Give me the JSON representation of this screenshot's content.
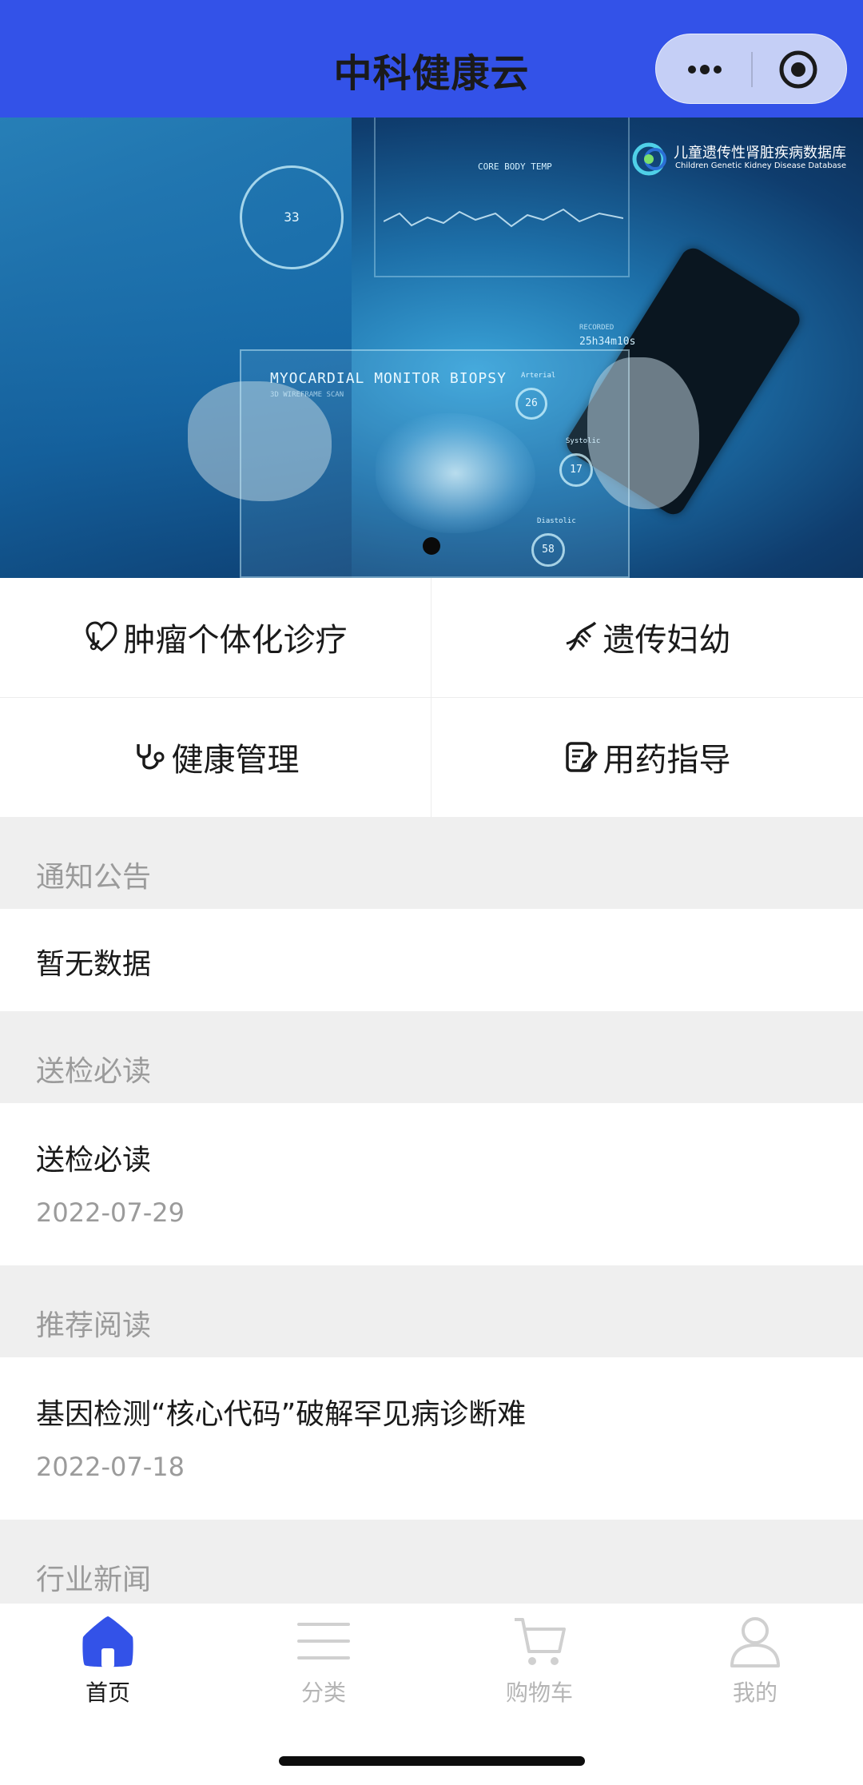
{
  "app": {
    "title": "中科健康云"
  },
  "banner": {
    "logo_cn": "儿童遗传性肾脏疾病数据库",
    "logo_en": "Children Genetic Kidney Disease Database",
    "panel_title": "MYOCARDIAL MONITOR BIOPSY",
    "panel_sub": "3D WIREFRAME SCAN",
    "screen_label": "CORE BODY TEMP",
    "recorded_label": "RECORDED",
    "recorded_time": "25h34m10s",
    "ring_values": [
      "26",
      "17",
      "58"
    ],
    "ring_labels": [
      "Arterial",
      "Systolic",
      "Diastolic"
    ],
    "left_ring_value": "33"
  },
  "services": [
    {
      "label": "肿瘤个体化诊疗",
      "icon": "stethoscope-heart-icon"
    },
    {
      "label": "遗传妇幼",
      "icon": "dna-icon"
    },
    {
      "label": "健康管理",
      "icon": "stethoscope-icon"
    },
    {
      "label": "用药指导",
      "icon": "edit-document-icon"
    }
  ],
  "sections": {
    "notice": {
      "heading": "通知公告",
      "empty_text": "暂无数据"
    },
    "inspection": {
      "heading": "送检必读",
      "title": "送检必读",
      "date": "2022-07-29"
    },
    "recommended": {
      "heading": "推荐阅读",
      "title": "基因检测“核心代码”破解罕见病诊断难",
      "date": "2022-07-18"
    },
    "industry": {
      "heading": "行业新闻"
    }
  },
  "tabbar": [
    {
      "label": "首页",
      "icon": "home-icon",
      "active": true
    },
    {
      "label": "分类",
      "icon": "list-icon",
      "active": false
    },
    {
      "label": "购物车",
      "icon": "cart-icon",
      "active": false
    },
    {
      "label": "我的",
      "icon": "user-icon",
      "active": false
    }
  ],
  "colors": {
    "brand": "#3352e8",
    "section_bg": "#efefef",
    "muted_text": "#9b9b9b"
  }
}
